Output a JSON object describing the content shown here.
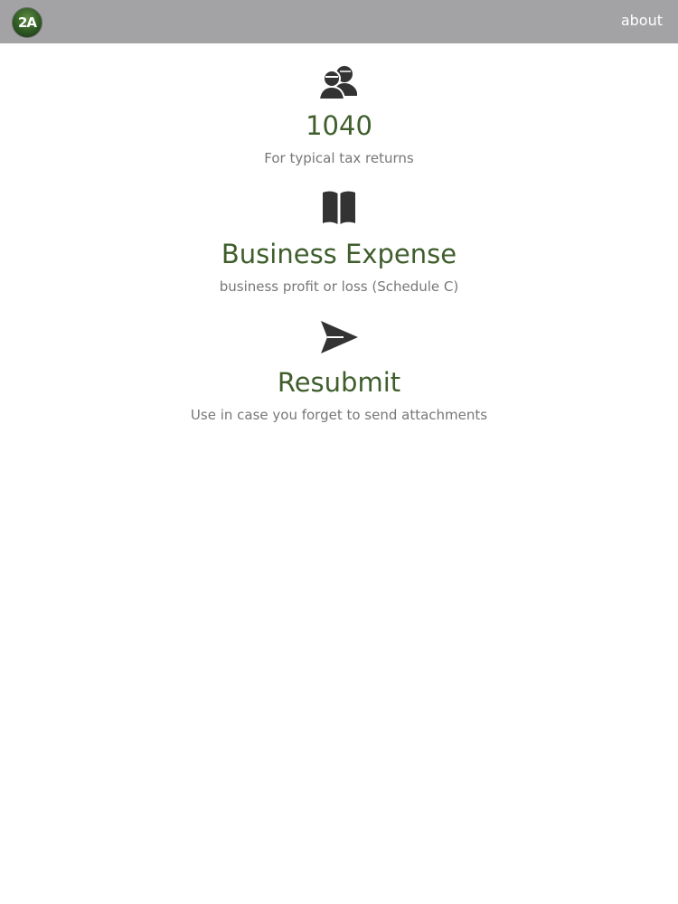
{
  "header": {
    "logo_text": "2A",
    "about_label": "about"
  },
  "options": [
    {
      "icon": "users-icon",
      "title": "1040",
      "description": "For typical tax returns"
    },
    {
      "icon": "book-icon",
      "title": "Business Expense",
      "description": "business profit or loss (Schedule C)"
    },
    {
      "icon": "send-icon",
      "title": "Resubmit",
      "description": "Use in case you forget to send attachments"
    }
  ],
  "colors": {
    "header_bg": "#a3a3a6",
    "title_green": "#3f5e2c",
    "description_gray": "#777777",
    "icon_dark": "#333333"
  }
}
